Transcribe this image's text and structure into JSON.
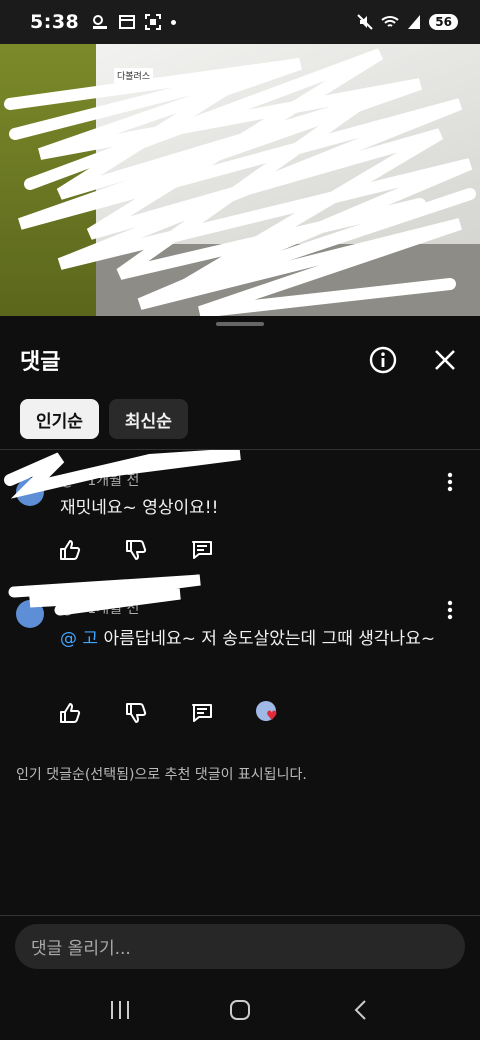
{
  "status_bar": {
    "time": "5:38",
    "battery": "56"
  },
  "video": {
    "channel_tag": "다볼려스"
  },
  "comments_panel": {
    "title": "댓글",
    "chips": [
      {
        "label": "인기순",
        "selected": true
      },
      {
        "label": "최신순",
        "selected": false
      }
    ],
    "comments": [
      {
        "meta": "@ · 1개월 전",
        "text": "재밋네요~ 영상이요!!"
      },
      {
        "meta": "@ · 1개월 전",
        "mention": "@ 고",
        "text": " 아름답네요~ 저 송도살았는데 그때 생각나요~"
      }
    ],
    "notice": "인기 댓글순(선택됨)으로 추천 댓글이 표시됩니다.",
    "compose_placeholder": "댓글 올리기..."
  },
  "colors": {
    "background": "#0f0f0f",
    "mention": "#3ea6ff",
    "heart": "#e02b3c"
  }
}
